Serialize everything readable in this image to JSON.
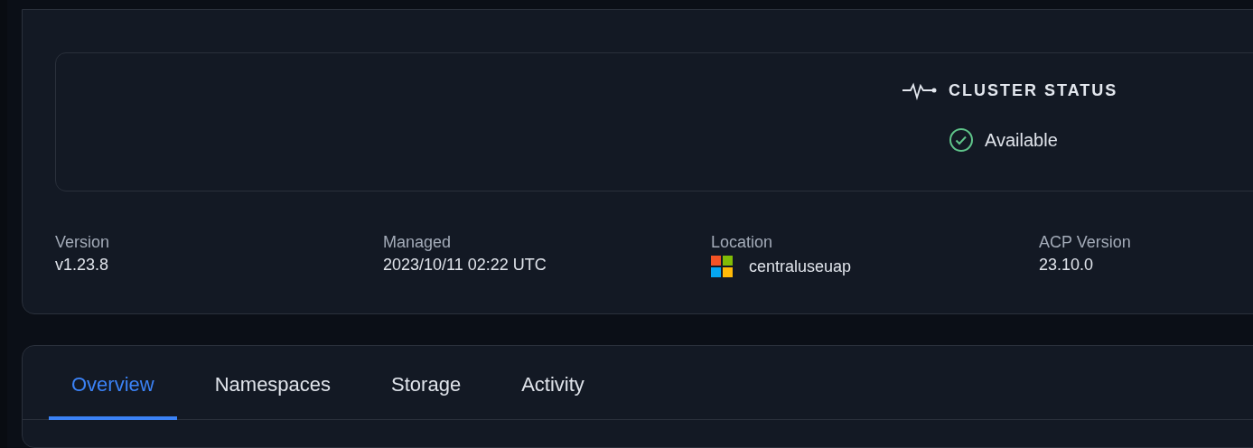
{
  "cluster_status": {
    "title": "CLUSTER STATUS",
    "state": "Available"
  },
  "details": [
    {
      "label": "Version",
      "value": "v1.23.8",
      "kind": "text"
    },
    {
      "label": "Managed",
      "value": "2023/10/11 02:22 UTC",
      "kind": "text"
    },
    {
      "label": "Location",
      "value": "centraluseuap",
      "kind": "cloud"
    },
    {
      "label": "ACP Version",
      "value": "23.10.0",
      "kind": "text"
    }
  ],
  "tabs": [
    {
      "label": "Overview",
      "selected": true
    },
    {
      "label": "Namespaces",
      "selected": false
    },
    {
      "label": "Storage",
      "selected": false
    },
    {
      "label": "Activity",
      "selected": false
    }
  ]
}
